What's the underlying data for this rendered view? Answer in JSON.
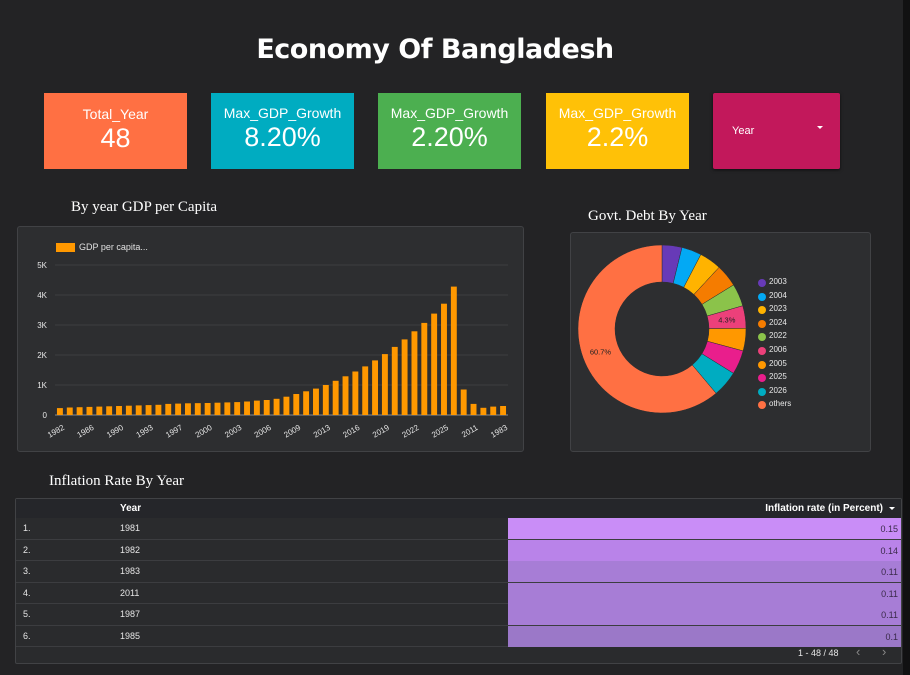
{
  "title": "Economy Of Bangladesh",
  "kpis": [
    {
      "label": "Total_Year",
      "value": "48",
      "color": "#ff7043"
    },
    {
      "label": "Max_GDP_Growth",
      "value": "8.20%",
      "color": "#00acc1"
    },
    {
      "label": "Max_GDP_Growth",
      "value": "2.20%",
      "color": "#4caf50"
    },
    {
      "label": "Max_GDP_Growth",
      "value": "2.2%",
      "color": "#ffc107"
    }
  ],
  "year_filter": {
    "label": "Year",
    "color": "#c2185b"
  },
  "gdp_title": "By  year GDP per Capita",
  "debt_title": "Govt. Debt By Year",
  "inflation_title": "Inflation Rate By Year",
  "chart_data": [
    {
      "type": "bar",
      "legend": "GDP per capita...",
      "color": "#ff9800",
      "ylim": [
        0,
        5000
      ],
      "yticks": [
        "0",
        "1K",
        "2K",
        "3K",
        "4K",
        "5K"
      ],
      "xtick_labels": [
        "1982",
        "1986",
        "1990",
        "1993",
        "1997",
        "2000",
        "2003",
        "2006",
        "2009",
        "2013",
        "2016",
        "2019",
        "2022",
        "2025",
        "2011",
        "1983"
      ],
      "values": [
        230,
        250,
        260,
        270,
        280,
        290,
        300,
        310,
        320,
        330,
        340,
        370,
        380,
        390,
        395,
        400,
        410,
        420,
        430,
        450,
        480,
        500,
        540,
        610,
        700,
        790,
        880,
        1000,
        1140,
        1290,
        1450,
        1620,
        1820,
        2030,
        2270,
        2520,
        2790,
        3070,
        3380,
        3710,
        4280,
        850,
        370,
        240,
        280,
        300
      ]
    },
    {
      "type": "pie",
      "slices": [
        {
          "label": "2003",
          "value": 3.8,
          "color": "#673ab7"
        },
        {
          "label": "2004",
          "value": 3.8,
          "color": "#03a9f4"
        },
        {
          "label": "2023",
          "value": 4.2,
          "color": "#ffb300"
        },
        {
          "label": "2024",
          "value": 4.3,
          "color": "#f57c00"
        },
        {
          "label": "2022",
          "value": 4.3,
          "color": "#8bc34a"
        },
        {
          "label": "2006",
          "value": 4.3,
          "color": "#ec407a"
        },
        {
          "label": "2005",
          "value": 4.3,
          "color": "#ff9800"
        },
        {
          "label": "2025",
          "value": 4.6,
          "color": "#e91e8c"
        },
        {
          "label": "2026",
          "value": 5.0,
          "color": "#00acc1"
        },
        {
          "label": "others",
          "value": 60.7,
          "color": "#ff7043"
        }
      ],
      "shown_labels": {
        "2006": "4.3%",
        "others": "60.7%"
      }
    }
  ],
  "table": {
    "col_year": "Year",
    "col_inflation": "Inflation rate (in Percent)",
    "rows": [
      {
        "idx": "1.",
        "year": "1981",
        "value": "0.15",
        "color": "#c98df7"
      },
      {
        "idx": "2.",
        "year": "1982",
        "value": "0.14",
        "color": "#b983e9"
      },
      {
        "idx": "3.",
        "year": "1983",
        "value": "0.11",
        "color": "#a77dd6"
      },
      {
        "idx": "4.",
        "year": "2011",
        "value": "0.11",
        "color": "#a77dd6"
      },
      {
        "idx": "5.",
        "year": "1987",
        "value": "0.11",
        "color": "#a77dd6"
      },
      {
        "idx": "6.",
        "year": "1985",
        "value": "0.1",
        "color": "#9b78c8"
      }
    ],
    "pager": "1 - 48 / 48"
  }
}
